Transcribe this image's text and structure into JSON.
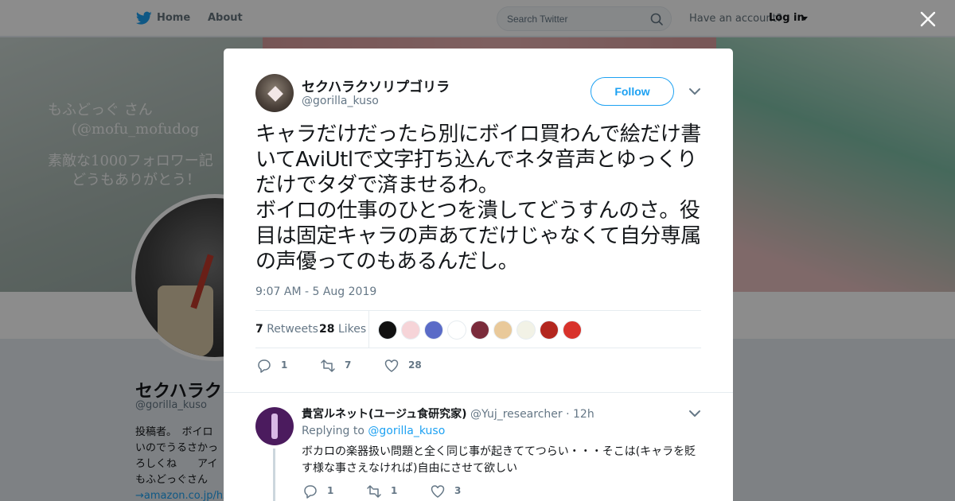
{
  "nav": {
    "home_label": "Home",
    "about_label": "About",
    "search_placeholder": "Search Twitter",
    "have_account": "Have an account?",
    "login_label": "Log in"
  },
  "banner": {
    "deco_line1": "もふどっぐ さん",
    "deco_line2": "(@mofu_mofudog",
    "deco_line3": "素敵な1000フォロワー記",
    "deco_line4": "どうもありがとう！"
  },
  "profile": {
    "name": "セクハラク",
    "handle": "@gorilla_kuso",
    "bio_line1": "投稿者。　ボイロ",
    "bio_line2": "いのでうるさかっ",
    "bio_line3": "ろしくね　　アイ",
    "bio_line4": "もふどっぐさん",
    "bio_link": "→amazon.co.jp/hz"
  },
  "tweet": {
    "author_name": "セクハラクソリプゴリラ",
    "author_handle": "@gorilla_kuso",
    "follow_label": "Follow",
    "text": "キャラだけだったら別にボイロ買わんで絵だけ書いてAviUtlで文字打ち込んでネタ音声とゆっくりだけでタダで済ませるわ。\nボイロの仕事のひとつを潰してどうすんのさ。役目は固定キャラの声あてだけじゃなくて自分専属の声優ってのもあるんだし。",
    "timestamp": "9:07 AM - 5 Aug 2019",
    "retweets_count": "7",
    "retweets_label": "Retweets",
    "likes_count": "28",
    "likes_label": "Likes",
    "replies_action": "1",
    "retweets_action": "7",
    "likes_action": "28"
  },
  "likers": [
    {
      "color": "#111111",
      "icon": "avatar-dark"
    },
    {
      "color": "#f6d4d8",
      "icon": "avatar-bunny"
    },
    {
      "color": "#5a6bc7",
      "icon": "avatar-girl-blue"
    },
    {
      "color": "#ffffff",
      "icon": "avatar-white"
    },
    {
      "color": "#7a2b3b",
      "icon": "avatar-maroon"
    },
    {
      "color": "#e9c99a",
      "icon": "avatar-glasses"
    },
    {
      "color": "#f2f2e6",
      "icon": "avatar-chick"
    },
    {
      "color": "#b3261e",
      "icon": "avatar-red"
    },
    {
      "color": "#d8322b",
      "icon": "avatar-hat"
    }
  ],
  "reply": {
    "name": "貴宮ルネット(ユージュ食研究家)",
    "handle": "@Yuj_researcher",
    "time": " · 12h",
    "replying_prefix": "Replying to",
    "replying_to": "@gorilla_kuso",
    "text": "ボカロの楽器扱い問題と全く同じ事が起きててつらい・・・そこは(キャラを貶す様な事さえなければ)自由にさせて欲しい",
    "replies": "1",
    "retweets": "1",
    "likes": "3"
  },
  "colors": {
    "brand": "#1da1f2",
    "text": "#14171a",
    "muted": "#657786"
  }
}
